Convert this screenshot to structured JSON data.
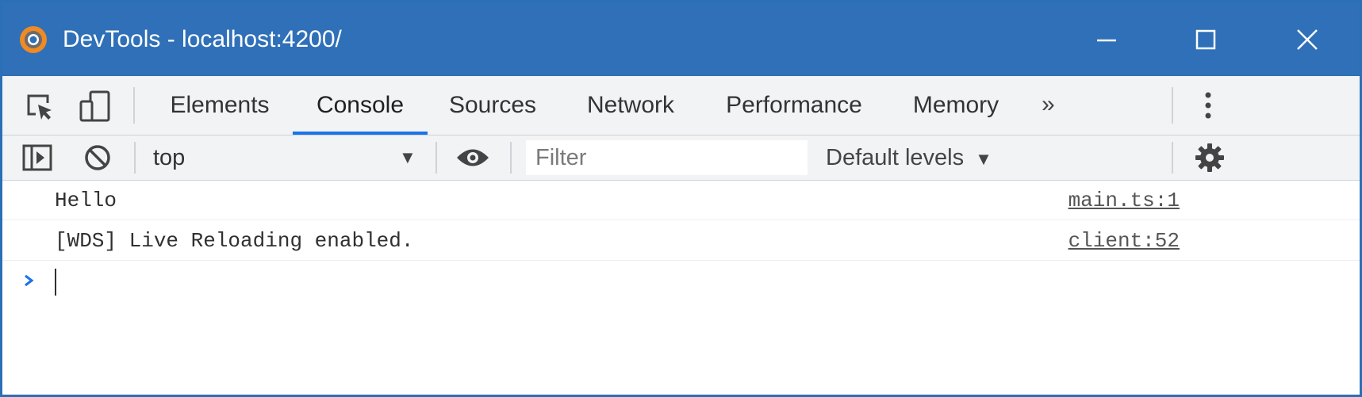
{
  "window": {
    "title": "DevTools - localhost:4200/",
    "icon": "chrome-devtools-icon",
    "controls": [
      "minimize-icon",
      "maximize-icon",
      "close-icon"
    ]
  },
  "toolbar": {
    "icons": [
      "inspect-element-icon",
      "device-toggle-icon",
      "more-options-icon"
    ],
    "tabs": [
      {
        "label": "Elements",
        "active": false
      },
      {
        "label": "Console",
        "active": true
      },
      {
        "label": "Sources",
        "active": false
      },
      {
        "label": "Network",
        "active": false
      },
      {
        "label": "Performance",
        "active": false
      },
      {
        "label": "Memory",
        "active": false
      }
    ],
    "overflow": "»"
  },
  "console_toolbar": {
    "icons": [
      "sidebar-toggle-icon",
      "clear-console-icon",
      "live-expression-eye-icon",
      "settings-gear-icon"
    ],
    "context": "top",
    "filter_placeholder": "Filter",
    "levels": "Default levels"
  },
  "messages": [
    {
      "text": "Hello",
      "source": "main.ts:1"
    },
    {
      "text": "[WDS] Live Reloading enabled.",
      "source": "client:52"
    }
  ],
  "colors": {
    "titlebar": "#2f70b8",
    "toolbar_bg": "#f1f3f4",
    "active_tab_underline": "#1a73e8",
    "prompt_chevron": "#1a73e8"
  }
}
